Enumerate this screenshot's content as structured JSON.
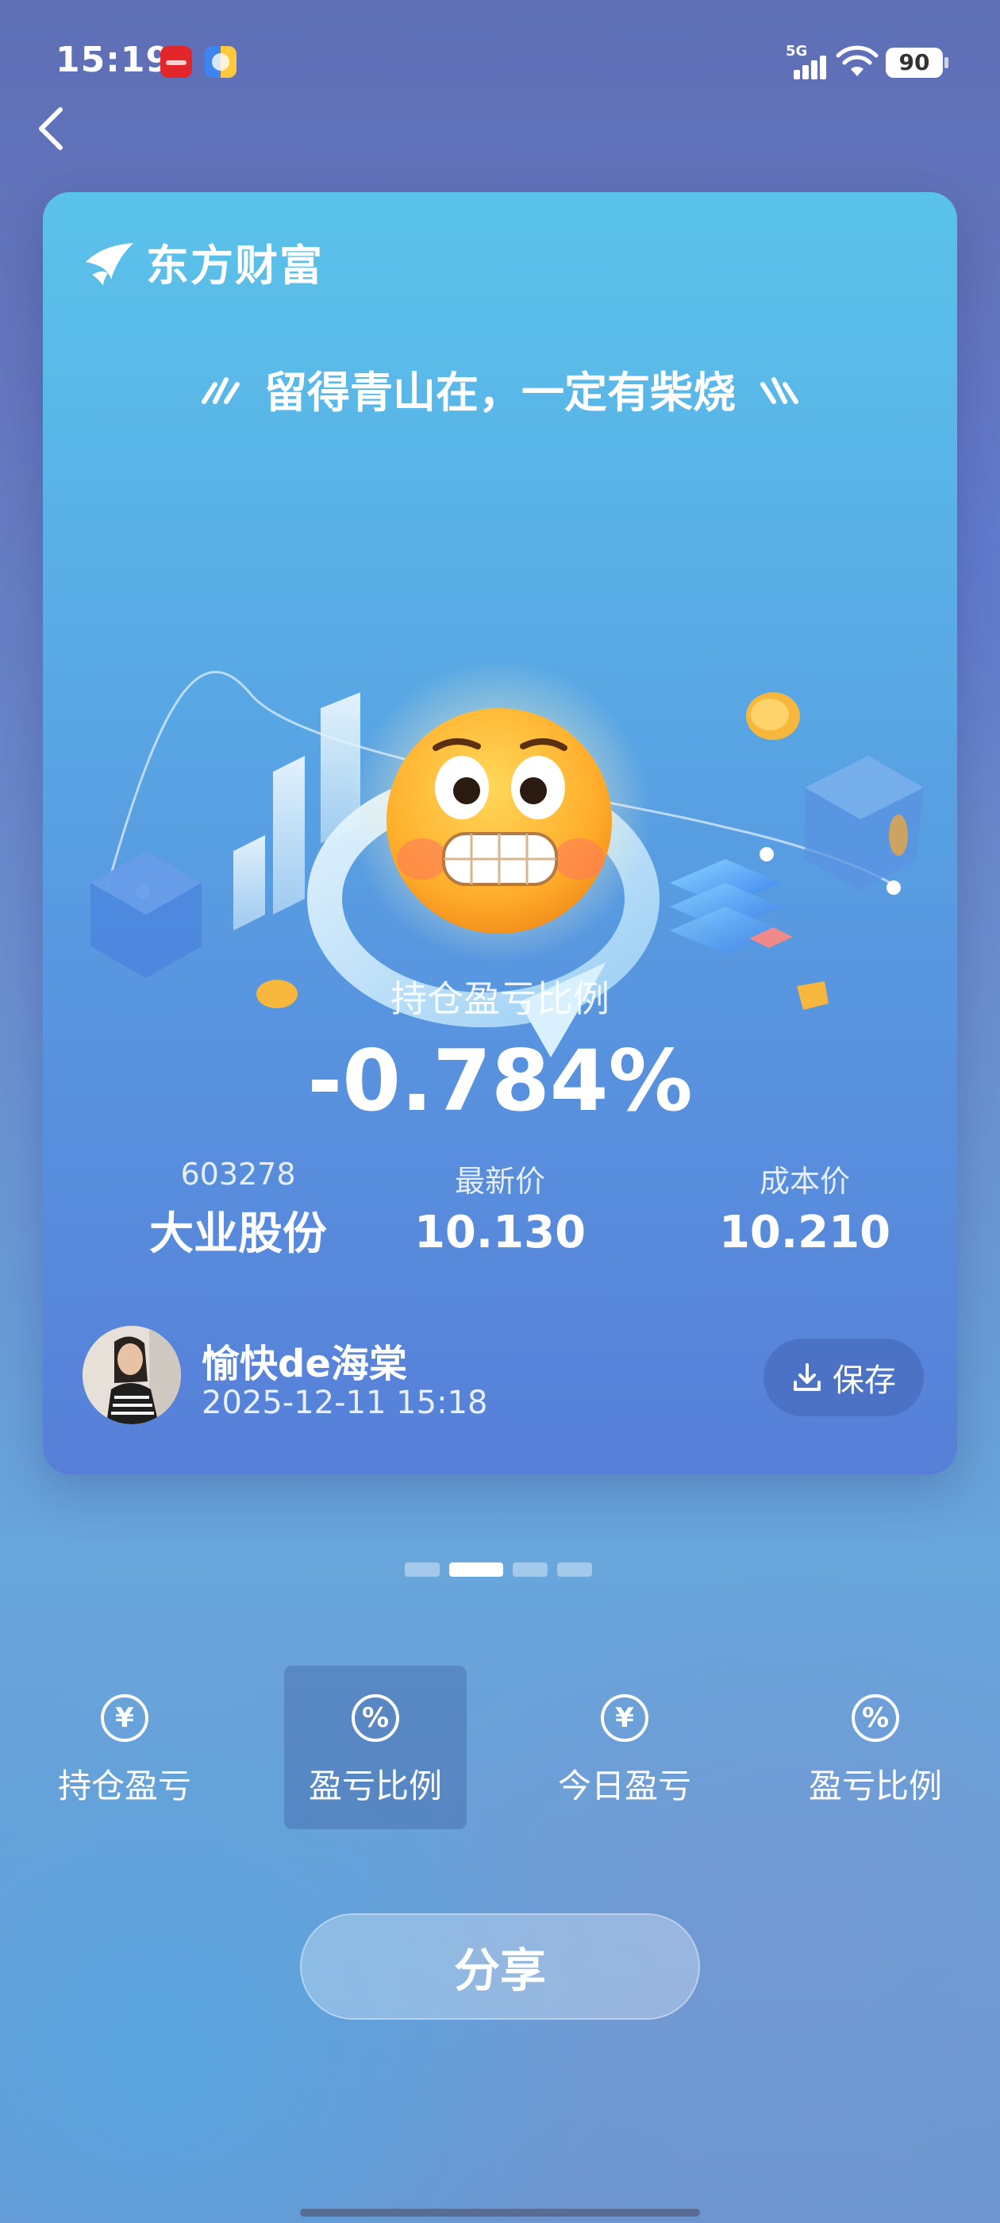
{
  "status": {
    "time": "15:19",
    "network": "5G",
    "battery": "90"
  },
  "nav": {
    "back_icon": "chevron-left-icon"
  },
  "card": {
    "brand": "东方财富",
    "slogan": "留得青山在，一定有柴烧",
    "ratio_label": "持仓盈亏比例",
    "ratio_value": "-0.784%",
    "stock": {
      "code": "603278",
      "name": "大业股份"
    },
    "latest_price": {
      "label": "最新价",
      "value": "10.130"
    },
    "cost_price": {
      "label": "成本价",
      "value": "10.210"
    },
    "user": {
      "name": "愉快de海棠",
      "timestamp": "2025-12-11 15:18"
    },
    "save_label": "保存"
  },
  "pager": {
    "count": 4,
    "active_index": 1
  },
  "tabs": [
    {
      "label": "持仓盈亏",
      "icon": "yen-circle-icon",
      "glyph": "¥"
    },
    {
      "label": "盈亏比例",
      "icon": "percent-circle-icon",
      "glyph": "%"
    },
    {
      "label": "今日盈亏",
      "icon": "yen-circle-icon",
      "glyph": "¥"
    },
    {
      "label": "盈亏比例",
      "icon": "percent-circle-icon",
      "glyph": "%"
    }
  ],
  "active_tab": 1,
  "share_label": "分享",
  "colors": {
    "card_top": "#5ac3ea",
    "card_bottom": "#577fd8",
    "accent": "#ffffff"
  }
}
